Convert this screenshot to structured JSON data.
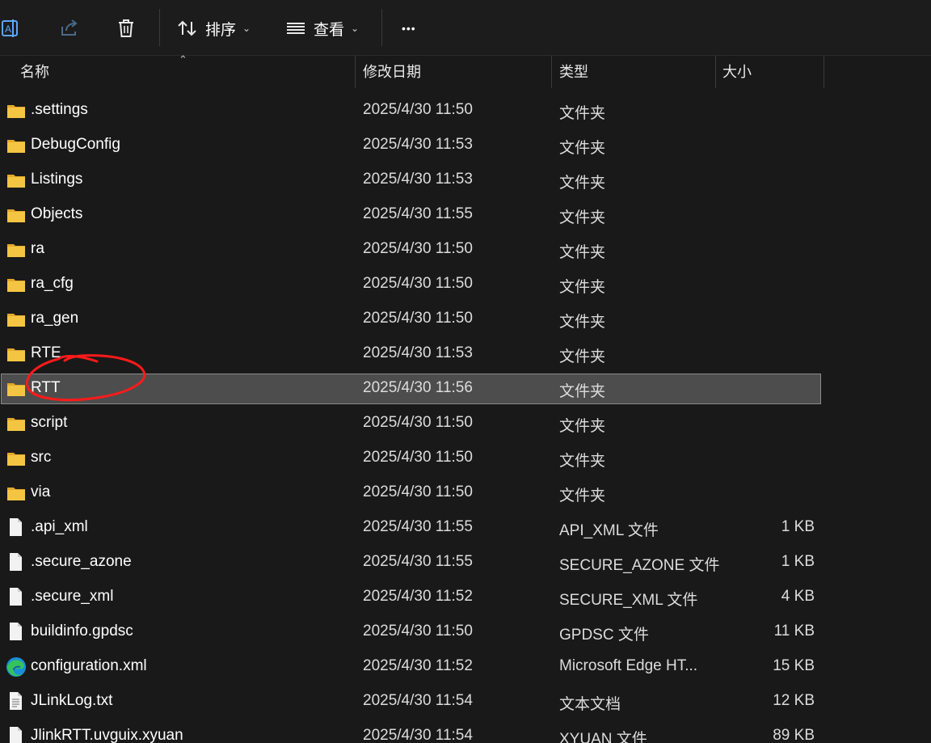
{
  "toolbar": {
    "sort_label": "排序",
    "view_label": "查看",
    "more_label": "•••",
    "icons": [
      "rename-icon",
      "share-icon",
      "delete-icon",
      "sort-icon",
      "view-icon",
      "more-icon"
    ]
  },
  "columns": {
    "name": "名称",
    "date": "修改日期",
    "type": "类型",
    "size": "大小"
  },
  "files": [
    {
      "name": ".settings",
      "date": "2025/4/30 11:50",
      "type": "文件夹",
      "size": "",
      "icon": "folder-icon"
    },
    {
      "name": "DebugConfig",
      "date": "2025/4/30 11:53",
      "type": "文件夹",
      "size": "",
      "icon": "folder-icon"
    },
    {
      "name": "Listings",
      "date": "2025/4/30 11:53",
      "type": "文件夹",
      "size": "",
      "icon": "folder-icon"
    },
    {
      "name": "Objects",
      "date": "2025/4/30 11:55",
      "type": "文件夹",
      "size": "",
      "icon": "folder-icon"
    },
    {
      "name": "ra",
      "date": "2025/4/30 11:50",
      "type": "文件夹",
      "size": "",
      "icon": "folder-icon"
    },
    {
      "name": "ra_cfg",
      "date": "2025/4/30 11:50",
      "type": "文件夹",
      "size": "",
      "icon": "folder-icon"
    },
    {
      "name": "ra_gen",
      "date": "2025/4/30 11:50",
      "type": "文件夹",
      "size": "",
      "icon": "folder-icon"
    },
    {
      "name": "RTE",
      "date": "2025/4/30 11:53",
      "type": "文件夹",
      "size": "",
      "icon": "folder-icon"
    },
    {
      "name": "RTT",
      "date": "2025/4/30 11:56",
      "type": "文件夹",
      "size": "",
      "icon": "folder-icon",
      "selected": true
    },
    {
      "name": "script",
      "date": "2025/4/30 11:50",
      "type": "文件夹",
      "size": "",
      "icon": "folder-icon"
    },
    {
      "name": "src",
      "date": "2025/4/30 11:50",
      "type": "文件夹",
      "size": "",
      "icon": "folder-icon"
    },
    {
      "name": "via",
      "date": "2025/4/30 11:50",
      "type": "文件夹",
      "size": "",
      "icon": "folder-icon"
    },
    {
      "name": ".api_xml",
      "date": "2025/4/30 11:55",
      "type": "API_XML 文件",
      "size": "1 KB",
      "icon": "file-icon"
    },
    {
      "name": ".secure_azone",
      "date": "2025/4/30 11:55",
      "type": "SECURE_AZONE 文件",
      "size": "1 KB",
      "icon": "file-icon"
    },
    {
      "name": ".secure_xml",
      "date": "2025/4/30 11:52",
      "type": "SECURE_XML 文件",
      "size": "4 KB",
      "icon": "file-icon"
    },
    {
      "name": "buildinfo.gpdsc",
      "date": "2025/4/30 11:50",
      "type": "GPDSC 文件",
      "size": "11 KB",
      "icon": "file-icon"
    },
    {
      "name": "configuration.xml",
      "date": "2025/4/30 11:52",
      "type": "Microsoft Edge HT...",
      "size": "15 KB",
      "icon": "edge-icon"
    },
    {
      "name": "JLinkLog.txt",
      "date": "2025/4/30 11:54",
      "type": "文本文档",
      "size": "12 KB",
      "icon": "text-file-icon"
    },
    {
      "name": "JlinkRTT.uvguix.xyuan",
      "date": "2025/4/30 11:54",
      "type": "XYUAN 文件",
      "size": "89 KB",
      "icon": "file-icon"
    }
  ],
  "colors": {
    "background": "#191919",
    "selected_row": "#4d4d4d",
    "folder": "#f4c542",
    "annotation": "#ff1a1a"
  }
}
